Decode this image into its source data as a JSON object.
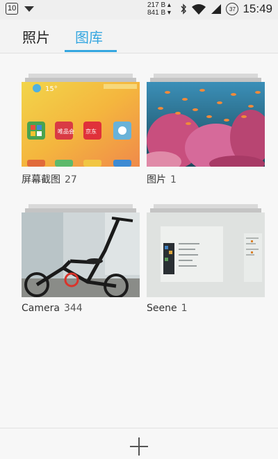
{
  "status_bar": {
    "notification_badge": "10",
    "upload_speed": "217 B ▴",
    "download_speed": "841 B ▾",
    "battery": "37",
    "time": "15:49"
  },
  "tabs": {
    "photos": "照片",
    "gallery": "图库",
    "active": "gallery",
    "accent_color": "#34a6e0"
  },
  "albums": [
    {
      "name": "屏幕截图",
      "count": "27"
    },
    {
      "name": "图片",
      "count": "1"
    },
    {
      "name": "Camera",
      "count": "344"
    },
    {
      "name": "Seene",
      "count": "1"
    }
  ],
  "screenshot_thumb": {
    "temperature": "15°",
    "app1": "唯品会",
    "app2": "京东"
  },
  "icons": [
    "wifi-icon",
    "bluetooth-icon",
    "signal-icon",
    "add-icon"
  ]
}
